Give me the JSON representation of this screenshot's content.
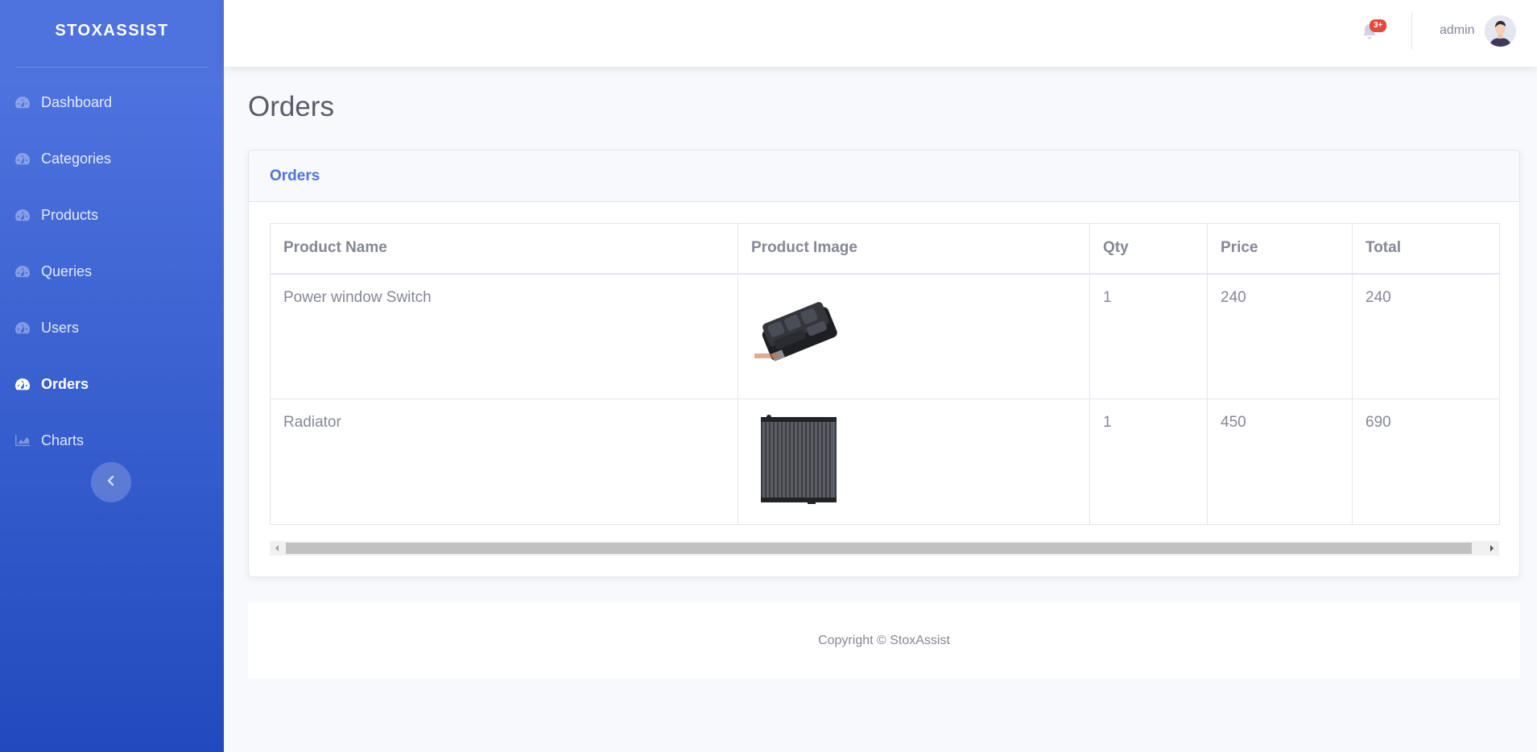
{
  "brand": "STOXASSIST",
  "sidebar": {
    "items": [
      {
        "label": "Dashboard",
        "icon": "gauge-icon",
        "active": false
      },
      {
        "label": "Categories",
        "icon": "gauge-icon",
        "active": false
      },
      {
        "label": "Products",
        "icon": "gauge-icon",
        "active": false
      },
      {
        "label": "Queries",
        "icon": "gauge-icon",
        "active": false
      },
      {
        "label": "Users",
        "icon": "gauge-icon",
        "active": false
      },
      {
        "label": "Orders",
        "icon": "gauge-icon",
        "active": true
      },
      {
        "label": "Charts",
        "icon": "area-chart-icon",
        "active": false
      }
    ],
    "toggle_icon": "chevron-left-icon"
  },
  "topbar": {
    "notification_badge": "3+",
    "user_name": "admin"
  },
  "page": {
    "title": "Orders"
  },
  "card": {
    "title": "Orders",
    "table": {
      "headers": [
        "Product Name",
        "Product Image",
        "Qty",
        "Price",
        "Total"
      ],
      "rows": [
        {
          "name": "Power window Switch",
          "image": "power-window-switch-image",
          "qty": "1",
          "price": "240",
          "total": "240"
        },
        {
          "name": "Radiator",
          "image": "radiator-image",
          "qty": "1",
          "price": "450",
          "total": "690"
        }
      ]
    }
  },
  "footer": {
    "copyright": "Copyright © StoxAssist"
  },
  "colors": {
    "primary": "#4e73df",
    "sidebar_gradient_end": "#224abe",
    "badge": "#e74a3b",
    "text": "#858796"
  }
}
